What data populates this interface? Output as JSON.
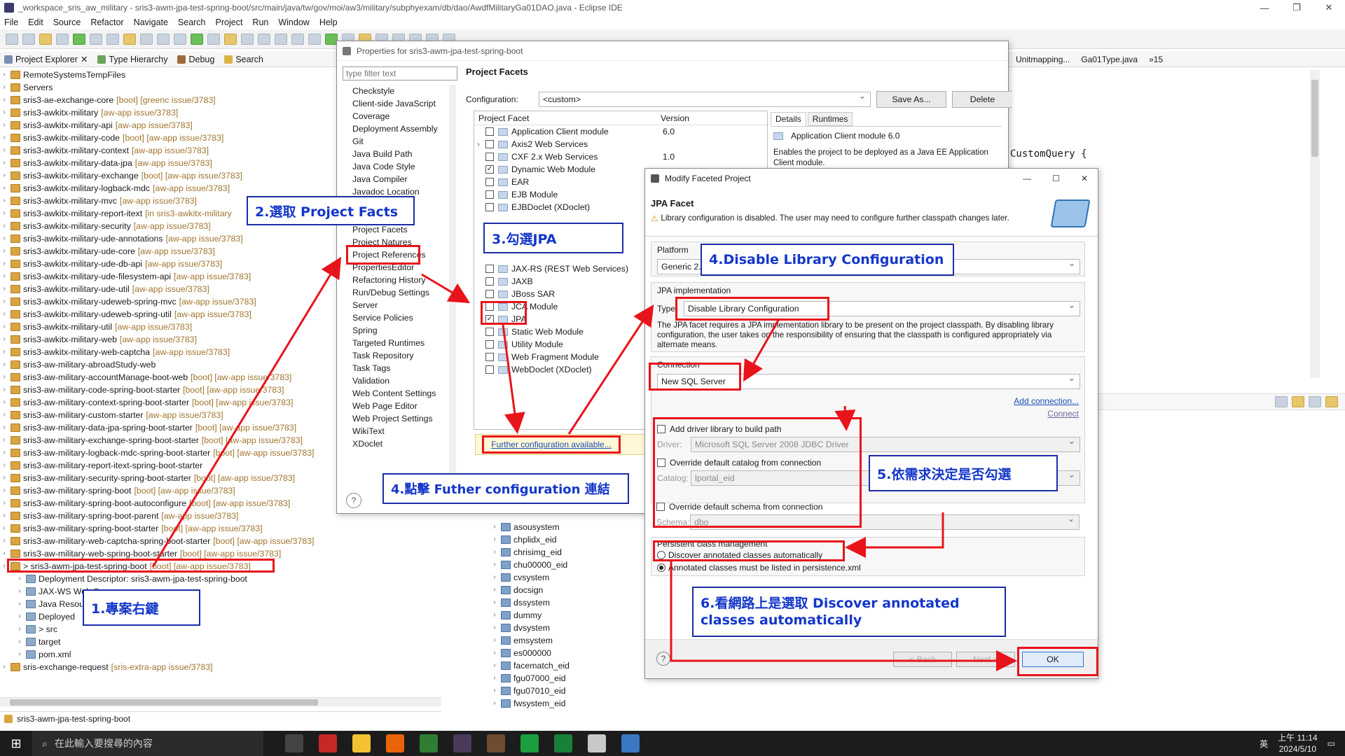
{
  "window": {
    "title": "_workspace_sris_aw_military - sris3-awm-jpa-test-spring-boot/src/main/java/tw/gov/moi/aw3/military/subphyexam/db/dao/AwdfMilitaryGa01DAO.java - Eclipse IDE"
  },
  "menu": [
    "File",
    "Edit",
    "Source",
    "Refactor",
    "Navigate",
    "Search",
    "Project",
    "Run",
    "Window",
    "Help"
  ],
  "views": {
    "project_explorer": "Project Explorer",
    "type_hierarchy": "Type Hierarchy",
    "debug": "Debug",
    "search": "Search"
  },
  "tree": [
    {
      "name": "RemoteSystemsTempFiles",
      "dec": ""
    },
    {
      "name": "Servers",
      "dec": ""
    },
    {
      "name": "sris3-ae-exchange-core",
      "dec": "[boot] [greenc issue/3783]"
    },
    {
      "name": "sris3-awkitx-military",
      "dec": "[aw-app issue/3783]"
    },
    {
      "name": "sris3-awkitx-military-api",
      "dec": "[aw-app issue/3783]"
    },
    {
      "name": "sris3-awkitx-military-code",
      "dec": "[boot] [aw-app issue/3783]"
    },
    {
      "name": "sris3-awkitx-military-context",
      "dec": "[aw-app issue/3783]"
    },
    {
      "name": "sris3-awkitx-military-data-jpa",
      "dec": "[aw-app issue/3783]"
    },
    {
      "name": "sris3-awkitx-military-exchange",
      "dec": "[boot] [aw-app issue/3783]"
    },
    {
      "name": "sris3-awkitx-military-logback-mdc",
      "dec": "[aw-app issue/3783]"
    },
    {
      "name": "sris3-awkitx-military-mvc",
      "dec": "[aw-app issue/3783]"
    },
    {
      "name": "sris3-awkitx-military-report-itext",
      "dec": "[in sris3-awkitx-military"
    },
    {
      "name": "sris3-awkitx-military-security",
      "dec": "[aw-app issue/3783]"
    },
    {
      "name": "sris3-awkitx-military-ude-annotations",
      "dec": "[aw-app issue/3783]"
    },
    {
      "name": "sris3-awkitx-military-ude-core",
      "dec": "[aw-app issue/3783]"
    },
    {
      "name": "sris3-awkitx-military-ude-db-api",
      "dec": "[aw-app issue/3783]"
    },
    {
      "name": "sris3-awkitx-military-ude-filesystem-api",
      "dec": "[aw-app issue/3783]"
    },
    {
      "name": "sris3-awkitx-military-ude-util",
      "dec": "[aw-app issue/3783]"
    },
    {
      "name": "sris3-awkitx-military-udeweb-spring-mvc",
      "dec": "[aw-app issue/3783]"
    },
    {
      "name": "sris3-awkitx-military-udeweb-spring-util",
      "dec": "[aw-app issue/3783]"
    },
    {
      "name": "sris3-awkitx-military-util",
      "dec": "[aw-app issue/3783]"
    },
    {
      "name": "sris3-awkitx-military-web",
      "dec": "[aw-app issue/3783]"
    },
    {
      "name": "sris3-awkitx-military-web-captcha",
      "dec": "[aw-app issue/3783]"
    },
    {
      "name": "sris3-aw-military-abroadStudy-web",
      "dec": ""
    },
    {
      "name": "sris3-aw-military-accountManage-boot-web",
      "dec": "[boot] [aw-app issue/3783]"
    },
    {
      "name": "sris3-aw-military-code-spring-boot-starter",
      "dec": "[boot] [aw-app issue/3783]"
    },
    {
      "name": "sris3-aw-military-context-spring-boot-starter",
      "dec": "[boot] [aw-app issue/3783]"
    },
    {
      "name": "sris3-aw-military-custom-starter",
      "dec": "[aw-app issue/3783]"
    },
    {
      "name": "sris3-aw-military-data-jpa-spring-boot-starter",
      "dec": "[boot] [aw-app issue/3783]"
    },
    {
      "name": "sris3-aw-military-exchange-spring-boot-starter",
      "dec": "[boot] [aw-app issue/3783]"
    },
    {
      "name": "sris3-aw-military-logback-mdc-spring-boot-starter",
      "dec": "[boot] [aw-app issue/3783]"
    },
    {
      "name": "sris3-aw-military-report-itext-spring-boot-starter",
      "dec": ""
    },
    {
      "name": "sris3-aw-military-security-spring-boot-starter",
      "dec": "[boot] [aw-app issue/3783]"
    },
    {
      "name": "sris3-aw-military-spring-boot",
      "dec": "[boot] [aw-app issue/3783]"
    },
    {
      "name": "sris3-aw-military-spring-boot-autoconfigure",
      "dec": "[boot] [aw-app issue/3783]"
    },
    {
      "name": "sris3-aw-military-spring-boot-parent",
      "dec": "[aw-app issue/3783]"
    },
    {
      "name": "sris3-aw-military-spring-boot-starter",
      "dec": "[boot] [aw-app issue/3783]"
    },
    {
      "name": "sris3-aw-military-web-captcha-spring-boot-starter",
      "dec": "[boot] [aw-app issue/3783]"
    },
    {
      "name": "sris3-aw-military-web-spring-boot-starter",
      "dec": "[boot] [aw-app issue/3783]"
    },
    {
      "name": "> sris3-awm-jpa-test-spring-boot",
      "dec": "[boot] [aw-app issue/3783]"
    }
  ],
  "subtree": [
    "Deployment Descriptor: sris3-awm-jpa-test-spring-boot",
    "JAX-WS Web S",
    "Java Resou",
    "Deployed",
    "> src",
    "target",
    "pom.xml"
  ],
  "tree_last": {
    "name": "sris-exchange-request",
    "dec": "[sris-extra-app issue/3783]"
  },
  "props": {
    "title": "Properties for sris3-awm-jpa-test-spring-boot",
    "filter_placeholder": "type filter text",
    "nav": [
      "Checkstyle",
      "Client-side JavaScript",
      "Coverage",
      "Deployment Assembly",
      "Git",
      "Java Build Path",
      "Java Code Style",
      "Java Compiler",
      "Javadoc Location",
      "Maven",
      "Project Archives",
      "Project Facets",
      "Project Natures",
      "Project References",
      "PropertiesEditor",
      "Refactoring History",
      "Run/Debug Settings",
      "Server",
      "Service Policies",
      "Spring",
      "Targeted Runtimes",
      "Task Repository",
      "Task Tags",
      "Validation",
      "Web Content Settings",
      "Web Page Editor",
      "Web Project Settings",
      "WikiText",
      "XDoclet"
    ],
    "heading": "Project Facets",
    "config_label": "Configuration:",
    "config_value": "<custom>",
    "save_as": "Save As...",
    "delete": "Delete",
    "col_facet": "Project Facet",
    "col_version": "Version",
    "facets": [
      {
        "name": "Application Client module",
        "ver": "6.0",
        "checked": false
      },
      {
        "name": "Axis2 Web Services",
        "ver": "",
        "checked": false
      },
      {
        "name": "CXF 2.x Web Services",
        "ver": "1.0",
        "checked": false
      },
      {
        "name": "Dynamic Web Module",
        "ver": "",
        "checked": true
      },
      {
        "name": "EAR",
        "ver": "",
        "checked": false
      },
      {
        "name": "EJB Module",
        "ver": "",
        "checked": false
      },
      {
        "name": "EJBDoclet (XDoclet)",
        "ver": "",
        "checked": false
      }
    ],
    "facets2": [
      {
        "name": "JAX-RS (REST Web Services)",
        "checked": false
      },
      {
        "name": "JAXB",
        "checked": false
      },
      {
        "name": "JBoss SAR",
        "checked": false
      },
      {
        "name": "JCA Module",
        "checked": false
      },
      {
        "name": "JPA",
        "checked": true
      },
      {
        "name": "Static Web Module",
        "checked": false
      },
      {
        "name": "Utility Module",
        "checked": false
      },
      {
        "name": "Web Fragment Module",
        "checked": false
      },
      {
        "name": "WebDoclet (XDoclet)",
        "checked": false
      }
    ],
    "tab_details": "Details",
    "tab_runtimes": "Runtimes",
    "detail_title": "Application Client module 6.0",
    "detail_text": "Enables the project to be deployed as a Java EE Application Client module.",
    "further": "Further configuration available..."
  },
  "jpa": {
    "title": "Modify Faceted Project",
    "heading": "JPA Facet",
    "warning": "Library configuration is disabled. The user may need to configure further classpath changes later.",
    "platform_label": "Platform",
    "platform_value": "Generic 2.",
    "impl_label": "JPA implementation",
    "type_label": "Type:",
    "type_value": "Disable Library Configuration",
    "impl_desc": "The JPA facet requires a JPA implementation library to be present on the project classpath. By disabling library configuration, the user takes on the responsibility of ensuring that the classpath is configured appropriately via alternate means.",
    "conn_label": "Connection",
    "conn_value": "New SQL Server",
    "add_conn": "Add connection...",
    "connect": "Connect",
    "add_driver": "Add driver library to build path",
    "driver_label": "Driver:",
    "driver_value": "Microsoft SQL Server 2008 JDBC Driver",
    "override_catalog": "Override default catalog from connection",
    "catalog_label": "Catalog:",
    "catalog_value": "lportal_eid",
    "override_schema": "Override default schema from connection",
    "schema_label": "Schema:",
    "schema_value": "dbo",
    "pcm_label": "Persistent class management",
    "discover": "Discover annotated classes automatically",
    "listed": "Annotated classes must be listed in persistence.xml",
    "back": "< Back",
    "next": "Next >",
    "ok": "OK"
  },
  "schemas": [
    "asousystem",
    "chplidx_eid",
    "chrisimg_eid",
    "chu00000_eid",
    "cvsystem",
    "docsign",
    "dssystem",
    "dummy",
    "dvsystem",
    "emsystem",
    "es000000",
    "facematch_eid",
    "fgu07000_eid",
    "fgu07010_eid",
    "fwsystem_eid"
  ],
  "editor": {
    "tab1": "Unitmapping...",
    "tab2": "Ga01Type.java",
    "tab_more": "»15",
    "code": "CustomQuery {",
    "side_label": "ge"
  },
  "callouts": {
    "c1": "1.專案右鍵",
    "c2": "2.選取 Project Facts",
    "c3": "3.勾選JPA",
    "c4": "4.點擊 Futher configuration 連結",
    "c5": "4.Disable Library Configuration",
    "c6": "5.依需求決定是否勾選",
    "c7": "6.看網路上是選取 Discover annotated classes automatically"
  },
  "status": {
    "text": "sris3-awm-jpa-test-spring-boot"
  },
  "taskbar": {
    "search": "在此輸入要搜尋的內容",
    "time": "上午 11:14",
    "date": "2024/5/10",
    "ime": "英"
  },
  "colors": {
    "accent_red": "#e8141b",
    "callout_blue": "#1437c9",
    "tree_decoration": "#a0752f"
  }
}
